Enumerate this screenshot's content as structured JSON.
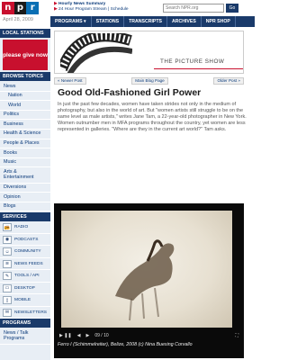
{
  "header": {
    "logo_letters": [
      "n",
      "p",
      "r"
    ],
    "date": "April 28, 2009",
    "promo_line1": "Hourly News Summary",
    "promo_line2a": "24 Hour Program Stream",
    "promo_line2b": "Schedule",
    "search_placeholder": "Search NPR.org",
    "search_button": "Go",
    "nav": [
      "PROGRAMS ▾",
      "STATIONS",
      "TRANSCRIPTS",
      "ARCHIVES",
      "NPR SHOP"
    ]
  },
  "sidebar": {
    "local_stations_title": "LOCAL STATIONS",
    "ad_text": "please give now",
    "browse_title": "BROWSE TOPICS",
    "topics": [
      {
        "label": "News",
        "sub": false
      },
      {
        "label": "Nation",
        "sub": true
      },
      {
        "label": "World",
        "sub": true
      },
      {
        "label": "Politics",
        "sub": false
      },
      {
        "label": "Business",
        "sub": false
      },
      {
        "label": "Health & Science",
        "sub": false
      },
      {
        "label": "People & Places",
        "sub": false
      },
      {
        "label": "Books",
        "sub": false
      },
      {
        "label": "Music",
        "sub": false
      },
      {
        "label": "Arts & Entertainment",
        "sub": false
      },
      {
        "label": "Diversions",
        "sub": false
      },
      {
        "label": "Opinion",
        "sub": false
      },
      {
        "label": "Blogs",
        "sub": false
      }
    ],
    "services_title": "SERVICES",
    "services": [
      {
        "label": "RADIO",
        "icon": "radio-icon",
        "glyph": "📻"
      },
      {
        "label": "PODCASTS",
        "icon": "podcast-icon",
        "glyph": "◉"
      },
      {
        "label": "COMMUNITY",
        "icon": "community-icon",
        "glyph": "☺"
      },
      {
        "label": "NEWS FEEDS",
        "icon": "rss-icon",
        "glyph": "≋"
      },
      {
        "label": "TOOLS / API",
        "icon": "tools-icon",
        "glyph": "✎"
      },
      {
        "label": "DESKTOP",
        "icon": "desktop-icon",
        "glyph": "▭"
      },
      {
        "label": "MOBILE",
        "icon": "mobile-icon",
        "glyph": "▯"
      },
      {
        "label": "NEWSLETTERS",
        "icon": "newsletter-icon",
        "glyph": "✉"
      }
    ],
    "programs_title": "PROGRAMS",
    "programs": [
      "News / Talk Programs"
    ]
  },
  "main": {
    "blog_title": "THE PICTURE SHOW",
    "newer_post": "« Newer Post",
    "main_page": "Main Blog Page",
    "older_post": "Older Post »",
    "headline": "Good Old-Fashioned Girl Power",
    "body": "In just the past few decades, women have taken strides not only in the medium of photography, but also in the world of art. But \"women artists still struggle to be on the same level as male artists,\" writes Jane Tam, a 22-year-old photographer in New York. Women outnumber men in MFA programs throughout the country, yet women are less represented in galleries. \"Where are they in the current art world?\" Tam asks.",
    "photo_counter": "09 / 10",
    "photo_caption": "Ferro I (Schimmelreiter), Belize, 2008 (c) Nina Buesing Corvallo"
  },
  "colors": {
    "npr_red": "#c8102e",
    "npr_black": "#1a1a1a",
    "npr_blue": "#0a6fb4",
    "navy": "#1a3a6a",
    "sidebar_bg": "#e8eef5"
  }
}
